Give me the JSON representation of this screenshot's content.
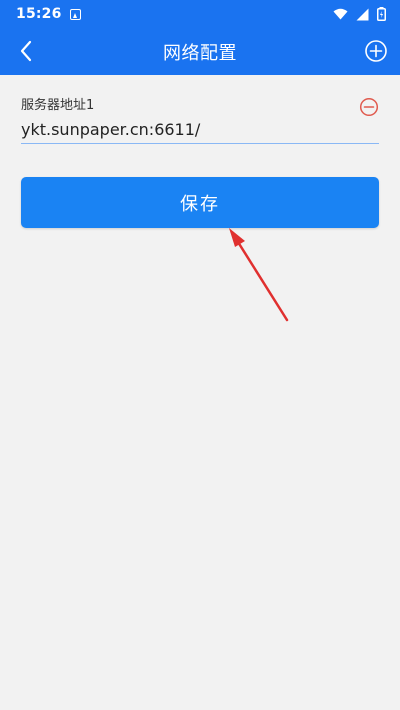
{
  "status_bar": {
    "time": "15:26",
    "icons": [
      "notification-icon",
      "wifi-icon",
      "signal-icon",
      "battery-icon"
    ]
  },
  "app_bar": {
    "title": "网络配置",
    "back_icon": "chevron-left-icon",
    "add_icon": "plus-circle-icon"
  },
  "server": {
    "label": "服务器地址1",
    "value": "ykt.sunpaper.cn:6611/",
    "remove_icon": "minus-circle-icon"
  },
  "save_button": {
    "label": "保存"
  },
  "colors": {
    "primary": "#1a73f0",
    "button": "#1a83f3",
    "background": "#f2f2f2",
    "remove": "#e05a4e",
    "annotation_arrow": "#e0302f"
  }
}
